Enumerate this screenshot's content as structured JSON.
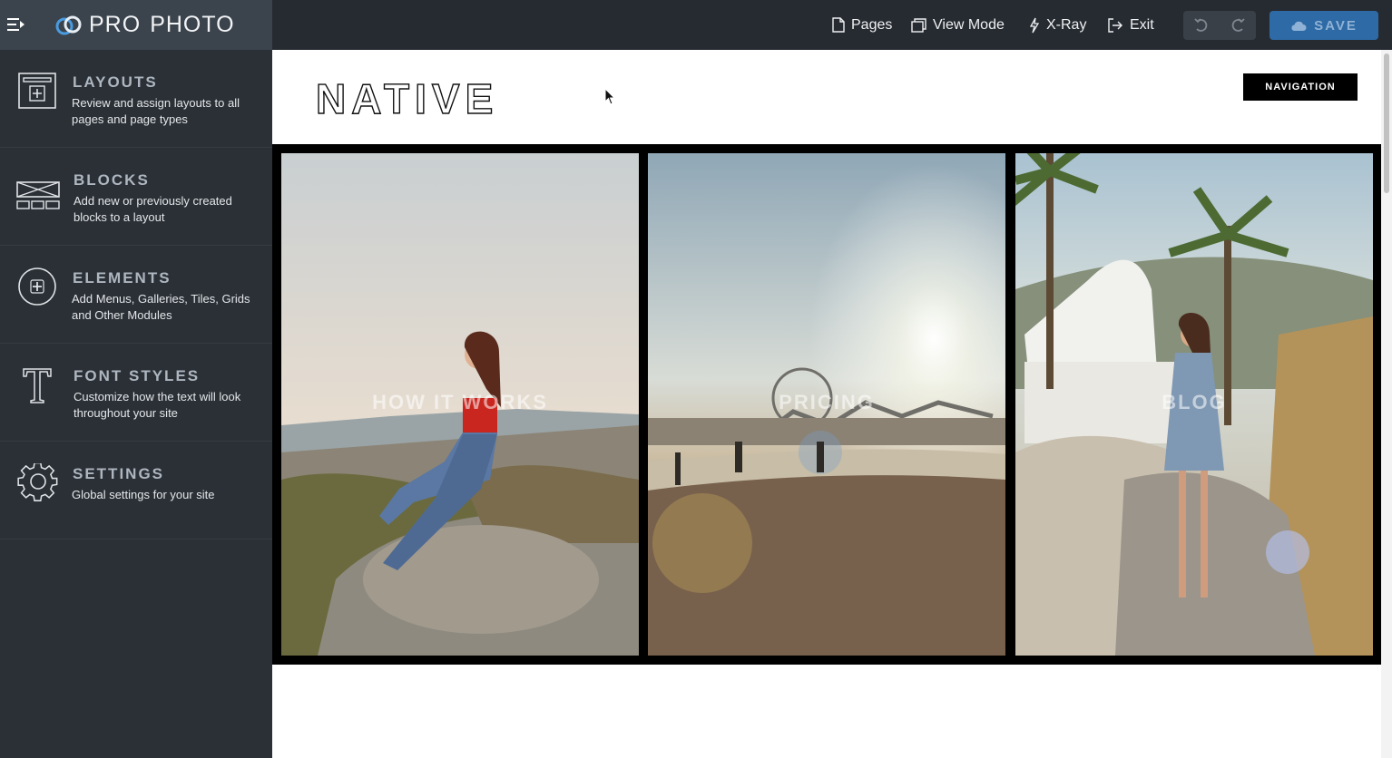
{
  "app": {
    "brand_name_part1": "PRO",
    "brand_name_part2": "PHOTO",
    "accent_color": "#2e6aa5"
  },
  "toolbar": {
    "pages_label": "Pages",
    "view_mode_label": "View Mode",
    "xray_label": "X-Ray",
    "exit_label": "Exit",
    "save_label": "SAVE",
    "icons": [
      "menu-toggle-icon",
      "page-icon",
      "view-mode-icon",
      "xray-icon",
      "exit-icon",
      "undo-icon",
      "redo-icon",
      "cloud-save-icon"
    ]
  },
  "sidebar": {
    "items": [
      {
        "title": "LAYOUTS",
        "description": "Review and assign layouts to all pages and page types",
        "icon": "layouts-icon"
      },
      {
        "title": "BLOCKS",
        "description": "Add new or previously created blocks to a layout",
        "icon": "blocks-icon"
      },
      {
        "title": "ELEMENTS",
        "description": "Add Menus, Galleries, Tiles, Grids and Other Modules",
        "icon": "elements-plus-icon"
      },
      {
        "title": "FONT STYLES",
        "description": "Customize how the text will look throughout your site",
        "icon": "font-styles-icon"
      },
      {
        "title": "SETTINGS",
        "description": "Global settings for your site",
        "icon": "gear-icon"
      }
    ]
  },
  "preview": {
    "site_logo_text": "NATIVE",
    "navigation_label": "NAVIGATION",
    "tiles": [
      {
        "label": "HOW IT WORKS"
      },
      {
        "label": "PRICING"
      },
      {
        "label": "BLOG"
      }
    ]
  }
}
